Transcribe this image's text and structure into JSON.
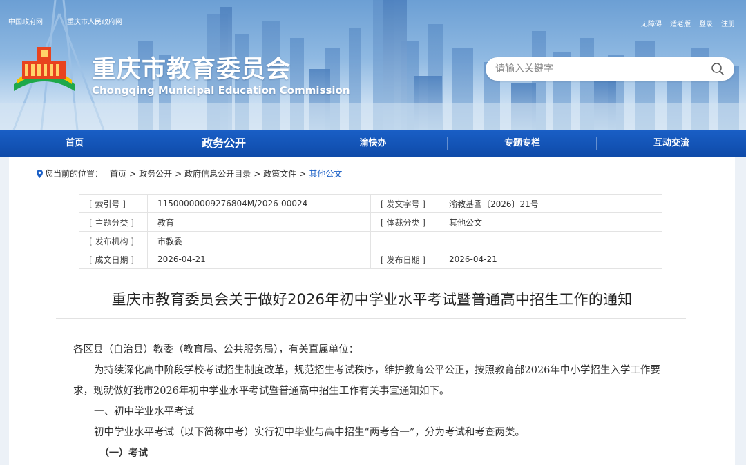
{
  "top_links_left": [
    "中国政府网",
    "重庆市人民政府网"
  ],
  "top_links_right": [
    "无障碍",
    "适老版",
    "登录",
    "注册"
  ],
  "site": {
    "title": "重庆市教育委员会",
    "subtitle": "Chongqing Municipal Education Commission"
  },
  "search": {
    "placeholder": "请输入关键字"
  },
  "nav": [
    "首页",
    "政务公开",
    "渝快办",
    "专题专栏",
    "互动交流"
  ],
  "nav_active": "政务公开",
  "breadcrumb": {
    "label": "您当前的位置：",
    "items": [
      "首页",
      "政务公开",
      "政府信息公开目录",
      "政策文件",
      "其他公文"
    ]
  },
  "meta": {
    "index_no_label": "[ 索引号 ]",
    "index_no": "11500000009276804M/2026-00024",
    "doc_no_label": "[ 发文字号 ]",
    "doc_no": "渝教基函〔2026〕21号",
    "topic_label": "[ 主题分类 ]",
    "topic": "教育",
    "genre_label": "[ 体裁分类 ]",
    "genre": "其他公文",
    "issuer_label": "[ 发布机构 ]",
    "issuer": "市教委",
    "created_label": "[ 成文日期 ]",
    "created": "2026-04-21",
    "published_label": "[ 发布日期 ]",
    "published": "2026-04-21"
  },
  "document": {
    "title": "重庆市教育委员会关于做好2026年初中学业水平考试暨普通高中招生工作的通知",
    "salutation": "各区县（自治县）教委（教育局、公共服务局），有关直属单位：",
    "para1": "为持续深化高中阶段学校考试招生制度改革，规范招生考试秩序，维护教育公平公正，按照教育部2026年中小学招生入学工作要求，现就做好我市2026年初中学业水平考试暨普通高中招生工作有关事宜通知如下。",
    "section1": "一、初中学业水平考试",
    "para2": "初中学业水平考试（以下简称中考）实行初中毕业与高中招生“两考合一”，分为考试和考查两类。",
    "subsection1": "（一）考试"
  },
  "colors": {
    "nav_blue": "#1a5fc6",
    "link_blue": "#1a5fc6"
  }
}
